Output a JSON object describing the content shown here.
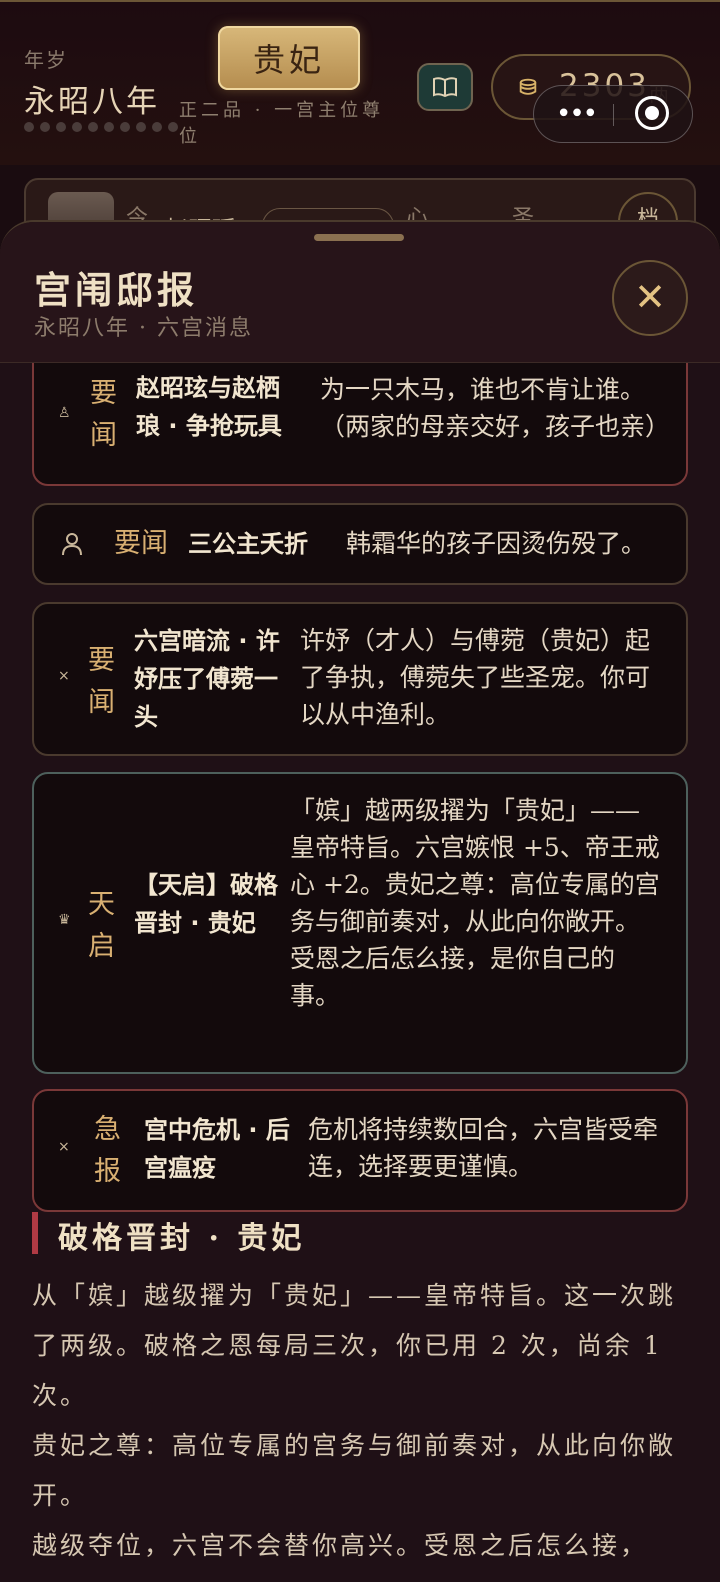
{
  "status": {
    "age_label": "年岁",
    "era": "永昭八年",
    "rank": "贵妃",
    "rank_desc": "正二品 · 一宫主位尊位",
    "coins": "2303",
    "coin_unit": "两",
    "book_icon": "book-icon",
    "coin_icon": "coin-icon"
  },
  "profile_strip": {
    "t1": "今",
    "name": "赵昭瑶",
    "t2": "心",
    "t3": "圣",
    "button": "档"
  },
  "sheet": {
    "title": "宫闱邸报",
    "subtitle": "永昭八年 · 六宫消息",
    "close_icon": "close-icon"
  },
  "news": [
    {
      "tag": "要闻",
      "title": "赵昭玹与赵栖琅 · 争抢玩具",
      "body": "为一只木马，谁也不肯让谁。（两家的母亲交好，孩子也亲）",
      "icon": "person-icon"
    },
    {
      "tag": "要闻",
      "title": "三公主夭折",
      "body": "韩霜华的孩子因烫伤殁了。",
      "icon": "person-icon"
    },
    {
      "tag": "要闻",
      "title": "六宫暗流 · 许妤压了傅菀一头",
      "body": "许妤（才人）与傅菀（贵妃）起了争执，傅菀失了些圣宠。你可以从中渔利。",
      "icon": "cross-icon"
    },
    {
      "tag": "天启",
      "title": "【天启】破格晋封 · 贵妃",
      "body": "「嫔」越两级擢为「贵妃」——皇帝特旨。六宫嫉恨 +5、帝王戒心 +2。贵妃之尊：高位专属的宫务与御前奏对，从此向你敞开。受恩之后怎么接，是你自己的事。",
      "icon": "crown-icon"
    },
    {
      "tag": "急报",
      "title": "宫中危机 · 后宫瘟疫",
      "body": "危机将持续数回合，六宫皆受牵连，选择要更谨慎。",
      "icon": "cross-icon"
    }
  ],
  "article": {
    "title": "破格晋封 · 贵妃",
    "p1": "从「嫔」越级擢为「贵妃」——皇帝特旨。这一次跳了两级。破格之恩每局三次，你已用 2 次，尚余 1 次。",
    "p2": "贵妃之尊：高位专属的宫务与御前奏对，从此向你敞开。",
    "p3": "越级夺位，六宫不会替你高兴。受恩之后怎么接，"
  }
}
